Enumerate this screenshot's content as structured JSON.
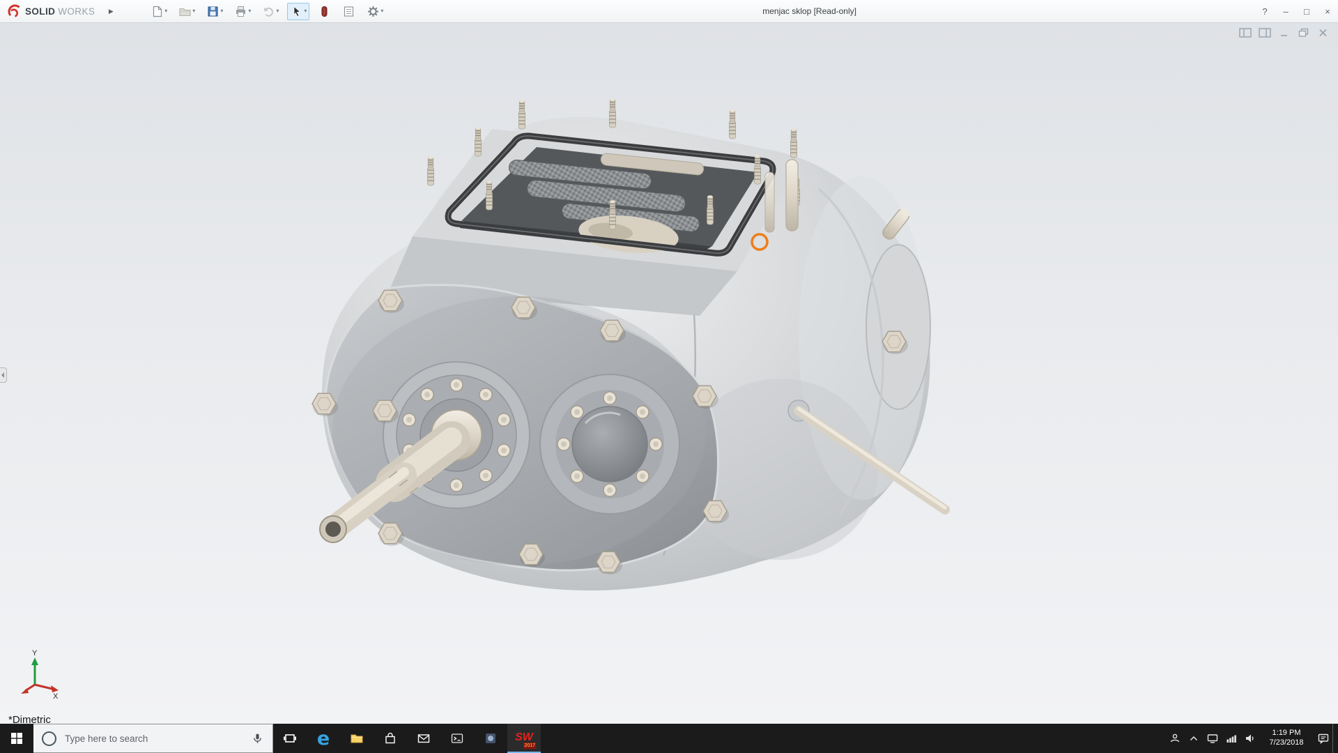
{
  "colors": {
    "solidworks_red": "#d1342c",
    "selection_highlight": "#ed7d19",
    "taskbar_bg": "#1b1b1c",
    "viewport_gradient_top": "#dfe2e6",
    "viewport_gradient_bottom": "#f2f3f5"
  },
  "window": {
    "brand_bold": "SOLID",
    "brand_light": "WORKS",
    "expander": "▶",
    "title": "menjac sklop [Read-only]",
    "help": "?",
    "controls": {
      "minimize": "–",
      "maximize": "□",
      "close": "×"
    }
  },
  "toolbar": {
    "caret": "▾",
    "icons": [
      "new-document",
      "open",
      "save",
      "print",
      "undo",
      "select",
      "appearances",
      "design-binder",
      "options-gear"
    ]
  },
  "viewport": {
    "view_label": "*Dimetric",
    "triad": {
      "x": "X",
      "y": "Y"
    },
    "doc_window_icons": [
      "split-pane",
      "full-pane",
      "minimize",
      "restore",
      "close"
    ],
    "model": "gearbox-assembly"
  },
  "taskbar": {
    "search": {
      "placeholder": "Type here to search"
    },
    "glyphs": {
      "edge": "e"
    },
    "solidworks": {
      "text": "SW",
      "year": "2017"
    },
    "app_icons": [
      "start",
      "cortana",
      "microphone",
      "task-view",
      "edge",
      "file-explorer",
      "store",
      "mail",
      "command-prompt",
      "app-tile",
      "solidworks-2017"
    ],
    "tray": {
      "icons": [
        "people",
        "chevron-up",
        "monitor",
        "network",
        "volume",
        "action-center"
      ],
      "time": "1:19 PM",
      "date": "7/23/2018"
    }
  }
}
